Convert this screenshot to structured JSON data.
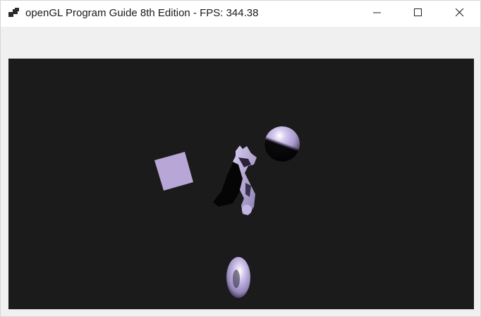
{
  "window": {
    "title": "openGL Program Guide 8th Edition - FPS: 344.38",
    "icons": {
      "app": "opengl-app-icon",
      "minimize": "minimize-icon",
      "maximize": "maximize-icon",
      "close": "close-icon"
    }
  },
  "scene": {
    "background_color": "#1b1b1b",
    "object_color": "#b8a6d6",
    "objects": [
      "quad",
      "dragon",
      "sphere",
      "torus"
    ]
  }
}
